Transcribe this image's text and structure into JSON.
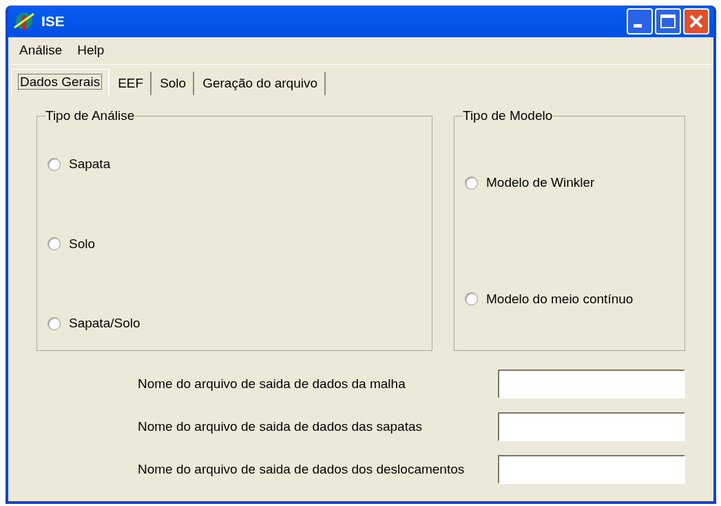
{
  "window": {
    "title": "ISE"
  },
  "menu": [
    "Análise",
    "Help"
  ],
  "tabs": [
    {
      "label": "Dados Gerais",
      "selected": true
    },
    {
      "label": "EEF",
      "selected": false
    },
    {
      "label": "Solo",
      "selected": false
    },
    {
      "label": "Geração do arquivo",
      "selected": false
    }
  ],
  "groups": [
    {
      "title": "Tipo de Análise",
      "options": [
        {
          "label": "Sapata",
          "selected": false
        },
        {
          "label": "Solo",
          "selected": false
        },
        {
          "label": "Sapata/Solo",
          "selected": false
        }
      ]
    },
    {
      "title": "Tipo de Modelo",
      "options": [
        {
          "label": "Modelo de Winkler",
          "selected": false
        },
        {
          "label": "Modelo do meio contínuo",
          "selected": false
        }
      ]
    }
  ],
  "fields": [
    {
      "label": "Nome do arquivo de saida de dados da malha"
    },
    {
      "label": "Nome do arquivo de saida de dados das sapatas"
    },
    {
      "label": "Nome do arquivo de saida de dados dos deslocamentos"
    }
  ]
}
